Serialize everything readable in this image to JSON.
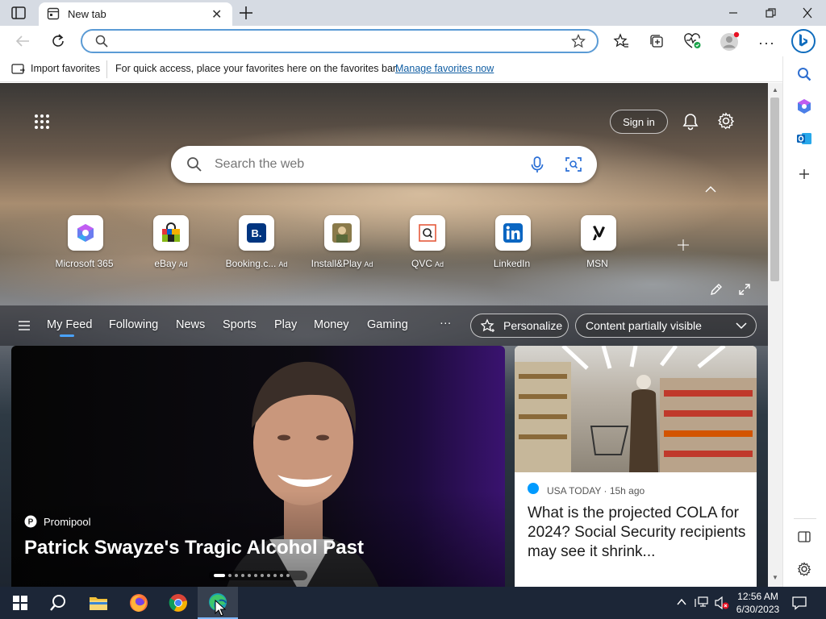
{
  "tab": {
    "title": "New tab"
  },
  "omnibox": {
    "value": "",
    "placeholder": ""
  },
  "favorites_bar": {
    "import_label": "Import favorites",
    "message": "For quick access, place your favorites here on the favorites bar.",
    "manage_link": "Manage favorites now"
  },
  "header": {
    "sign_in": "Sign in"
  },
  "search": {
    "placeholder": "Search the web"
  },
  "quick_links": [
    {
      "label": "Microsoft 365",
      "ad": ""
    },
    {
      "label": "eBay",
      "ad": "Ad"
    },
    {
      "label": "Booking.c...",
      "ad": "Ad"
    },
    {
      "label": "Install&Play",
      "ad": "Ad"
    },
    {
      "label": "QVC",
      "ad": "Ad"
    },
    {
      "label": "LinkedIn",
      "ad": ""
    },
    {
      "label": "MSN",
      "ad": ""
    }
  ],
  "feed_nav": {
    "items": [
      "My Feed",
      "Following",
      "News",
      "Sports",
      "Play",
      "Money",
      "Gaming"
    ],
    "more": "···",
    "personalize": "Personalize",
    "visibility": "Content partially visible"
  },
  "hero_card": {
    "source": "Promipool",
    "headline": "Patrick Swayze's Tragic Alcohol Past",
    "carousel_count": 11,
    "carousel_active": 1
  },
  "side_card": {
    "source": "USA TODAY",
    "age": "15h ago",
    "headline": "What is the projected COLA for 2024? Social Security recipients may see it shrink..."
  },
  "taskbar": {
    "time": "12:56 AM",
    "date": "6/30/2023"
  },
  "colors": {
    "accent": "#0f6cbd",
    "link": "#115ea3",
    "taskbar": "#1c2637"
  }
}
